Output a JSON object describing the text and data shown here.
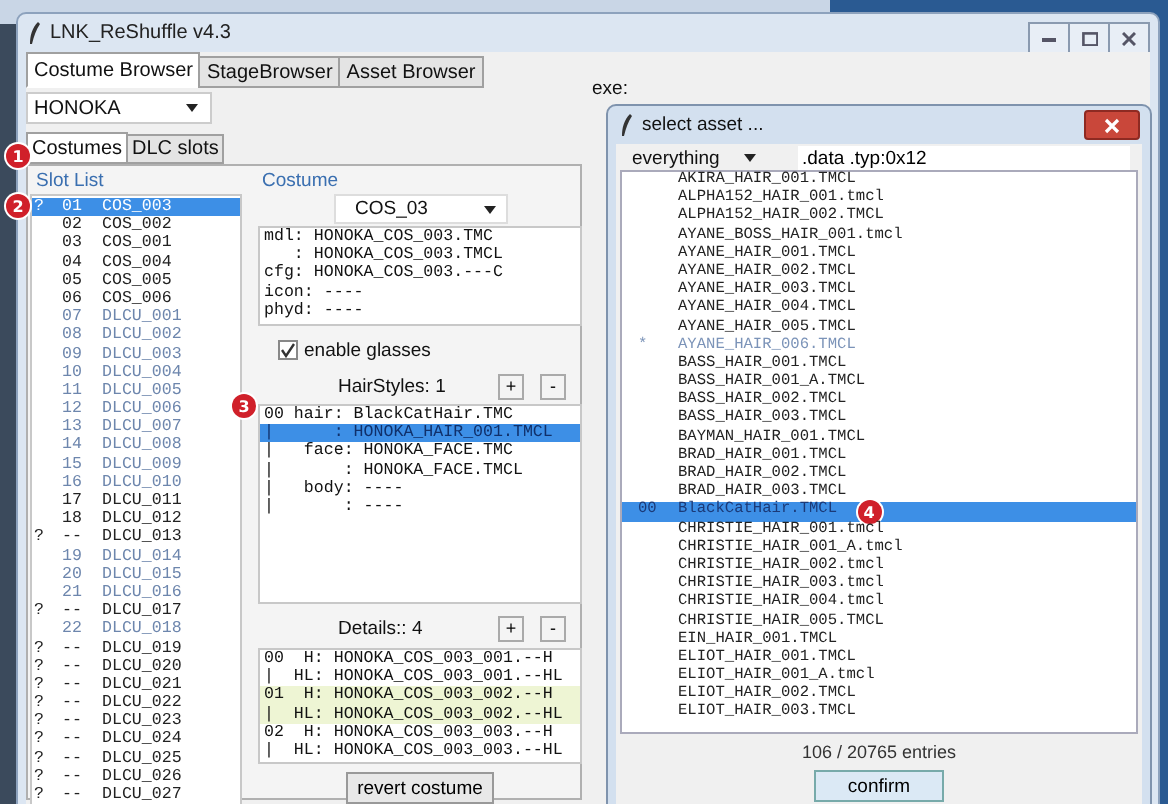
{
  "window": {
    "title": "LNK_ReShuffle v4.3"
  },
  "tabs": [
    {
      "label": "Costume Browser",
      "selected": true
    },
    {
      "label": "StageBrowser",
      "selected": false
    },
    {
      "label": "Asset Browser",
      "selected": false
    }
  ],
  "character": "HONOKA",
  "subtabs": [
    {
      "label": "Costumes",
      "selected": true
    },
    {
      "label": "DLC slots",
      "selected": false
    }
  ],
  "slot_list": {
    "title": "Slot List",
    "rows": [
      {
        "mark": "?",
        "number": "01",
        "name": "COS_003",
        "kind": "plain",
        "selected": true
      },
      {
        "number": "02",
        "name": "COS_002",
        "kind": "plain",
        "selected": false
      },
      {
        "number": "03",
        "name": "COS_001",
        "kind": "plain",
        "selected": false
      },
      {
        "number": "04",
        "name": "COS_004",
        "kind": "plain",
        "selected": false
      },
      {
        "number": "05",
        "name": "COS_005",
        "kind": "plain",
        "selected": false
      },
      {
        "number": "06",
        "name": "COS_006",
        "kind": "plain",
        "selected": false
      },
      {
        "number": "07",
        "name": "DLCU_001",
        "kind": "faded",
        "selected": false
      },
      {
        "number": "08",
        "name": "DLCU_002",
        "kind": "faded",
        "selected": false
      },
      {
        "number": "09",
        "name": "DLCU_003",
        "kind": "faded",
        "selected": false
      },
      {
        "number": "10",
        "name": "DLCU_004",
        "kind": "faded",
        "selected": false
      },
      {
        "number": "11",
        "name": "DLCU_005",
        "kind": "faded",
        "selected": false
      },
      {
        "number": "12",
        "name": "DLCU_006",
        "kind": "faded",
        "selected": false
      },
      {
        "number": "13",
        "name": "DLCU_007",
        "kind": "faded",
        "selected": false
      },
      {
        "number": "14",
        "name": "DLCU_008",
        "kind": "faded",
        "selected": false
      },
      {
        "number": "15",
        "name": "DLCU_009",
        "kind": "faded",
        "selected": false
      },
      {
        "number": "16",
        "name": "DLCU_010",
        "kind": "faded",
        "selected": false
      },
      {
        "number": "17",
        "name": "DLCU_011",
        "kind": "plain",
        "selected": false
      },
      {
        "number": "18",
        "name": "DLCU_012",
        "kind": "plain",
        "selected": false
      },
      {
        "mark": "?",
        "number": "--",
        "name": "DLCU_013",
        "kind": "plain",
        "selected": false
      },
      {
        "number": "19",
        "name": "DLCU_014",
        "kind": "faded",
        "selected": false
      },
      {
        "number": "20",
        "name": "DLCU_015",
        "kind": "faded",
        "selected": false
      },
      {
        "number": "21",
        "name": "DLCU_016",
        "kind": "faded",
        "selected": false
      },
      {
        "mark": "?",
        "number": "--",
        "name": "DLCU_017",
        "kind": "plain",
        "selected": false
      },
      {
        "number": "22",
        "name": "DLCU_018",
        "kind": "faded",
        "selected": false
      },
      {
        "mark": "?",
        "number": "--",
        "name": "DLCU_019",
        "kind": "plain",
        "selected": false
      },
      {
        "mark": "?",
        "number": "--",
        "name": "DLCU_020",
        "kind": "plain",
        "selected": false
      },
      {
        "mark": "?",
        "number": "--",
        "name": "DLCU_021",
        "kind": "plain",
        "selected": false
      },
      {
        "mark": "?",
        "number": "--",
        "name": "DLCU_022",
        "kind": "plain",
        "selected": false
      },
      {
        "mark": "?",
        "number": "--",
        "name": "DLCU_023",
        "kind": "plain",
        "selected": false
      },
      {
        "mark": "?",
        "number": "--",
        "name": "DLCU_024",
        "kind": "plain",
        "selected": false
      },
      {
        "mark": "?",
        "number": "--",
        "name": "DLCU_025",
        "kind": "plain",
        "selected": false
      },
      {
        "mark": "?",
        "number": "--",
        "name": "DLCU_026",
        "kind": "plain",
        "selected": false
      },
      {
        "mark": "?",
        "number": "--",
        "name": "DLCU_027",
        "kind": "plain",
        "selected": false
      }
    ]
  },
  "costume": {
    "title": "Costume",
    "selected": "COS_03",
    "info": [
      "mdl: HONOKA_COS_003.TMC",
      "   : HONOKA_COS_003.TMCL",
      "cfg: HONOKA_COS_003.---C",
      "icon: ----",
      "phyd: ----"
    ],
    "enable_glasses": {
      "label": "enable glasses",
      "checked": true
    },
    "hairstyles": {
      "label": "HairStyles: 1",
      "buttons": [
        "+",
        "-"
      ],
      "lines": [
        {
          "text": "00 hair: BlackCatHair.TMC",
          "selected": false
        },
        {
          "text": "|      : HONOKA_HAIR_001.TMCL",
          "selected": true
        },
        {
          "text": "|   face: HONOKA_FACE.TMC",
          "selected": false
        },
        {
          "text": "|       : HONOKA_FACE.TMCL",
          "selected": false
        },
        {
          "text": "|   body: ----",
          "selected": false
        },
        {
          "text": "|       : ----",
          "selected": false
        }
      ]
    },
    "details": {
      "label": "Details:: 4",
      "buttons": [
        "+",
        "-"
      ],
      "lines": [
        {
          "text": "00  H: HONOKA_COS_003_001.--H",
          "highlighted": false
        },
        {
          "text": "|  HL: HONOKA_COS_003_001.--HL",
          "highlighted": false
        },
        {
          "text": "01  H: HONOKA_COS_003_002.--H",
          "highlighted": true
        },
        {
          "text": "|  HL: HONOKA_COS_003_002.--HL",
          "highlighted": true
        },
        {
          "text": "02  H: HONOKA_COS_003_003.--H",
          "highlighted": false
        },
        {
          "text": "|  HL: HONOKA_COS_003_003.--HL",
          "highlighted": false
        }
      ]
    },
    "revert_button": "revert costume"
  },
  "exe_label": "exe:",
  "dialog": {
    "title": "select asset ...",
    "filter": "everything",
    "query": ".data .typ:0x12",
    "assets": [
      {
        "name": "AKIRA_HAIR_001.TMCL",
        "kind": "plain",
        "selected": false
      },
      {
        "name": "ALPHA152_HAIR_001.tmcl",
        "kind": "plain",
        "selected": false
      },
      {
        "name": "ALPHA152_HAIR_002.TMCL",
        "kind": "plain",
        "selected": false
      },
      {
        "name": "AYANE_BOSS_HAIR_001.tmcl",
        "kind": "plain",
        "selected": false
      },
      {
        "name": "AYANE_HAIR_001.TMCL",
        "kind": "plain",
        "selected": false
      },
      {
        "name": "AYANE_HAIR_002.TMCL",
        "kind": "plain",
        "selected": false
      },
      {
        "name": "AYANE_HAIR_003.TMCL",
        "kind": "plain",
        "selected": false
      },
      {
        "name": "AYANE_HAIR_004.TMCL",
        "kind": "plain",
        "selected": false
      },
      {
        "name": "AYANE_HAIR_005.TMCL",
        "kind": "plain",
        "selected": false
      },
      {
        "mark": "*",
        "name": "AYANE_HAIR_006.TMCL",
        "kind": "faded",
        "selected": false
      },
      {
        "name": "BASS_HAIR_001.TMCL",
        "kind": "plain",
        "selected": false
      },
      {
        "name": "BASS_HAIR_001_A.TMCL",
        "kind": "plain",
        "selected": false
      },
      {
        "name": "BASS_HAIR_002.TMCL",
        "kind": "plain",
        "selected": false
      },
      {
        "name": "BASS_HAIR_003.TMCL",
        "kind": "plain",
        "selected": false
      },
      {
        "name": "BAYMAN_HAIR_001.TMCL",
        "kind": "plain",
        "selected": false
      },
      {
        "name": "BRAD_HAIR_001.TMCL",
        "kind": "plain",
        "selected": false
      },
      {
        "name": "BRAD_HAIR_002.TMCL",
        "kind": "plain",
        "selected": false
      },
      {
        "name": "BRAD_HAIR_003.TMCL",
        "kind": "plain",
        "selected": false
      },
      {
        "mark": "00",
        "name": "BlackCatHair.TMCL",
        "kind": "plain",
        "selected": true
      },
      {
        "name": "CHRISTIE_HAIR_001.tmcl",
        "kind": "plain",
        "selected": false
      },
      {
        "name": "CHRISTIE_HAIR_001_A.tmcl",
        "kind": "plain",
        "selected": false
      },
      {
        "name": "CHRISTIE_HAIR_002.tmcl",
        "kind": "plain",
        "selected": false
      },
      {
        "name": "CHRISTIE_HAIR_003.tmcl",
        "kind": "plain",
        "selected": false
      },
      {
        "name": "CHRISTIE_HAIR_004.tmcl",
        "kind": "plain",
        "selected": false
      },
      {
        "name": "CHRISTIE_HAIR_005.TMCL",
        "kind": "plain",
        "selected": false
      },
      {
        "name": "EIN_HAIR_001.TMCL",
        "kind": "plain",
        "selected": false
      },
      {
        "name": "ELIOT_HAIR_001.TMCL",
        "kind": "plain",
        "selected": false
      },
      {
        "name": "ELIOT_HAIR_001_A.tmcl",
        "kind": "plain",
        "selected": false
      },
      {
        "name": "ELIOT_HAIR_002.TMCL",
        "kind": "plain",
        "selected": false
      },
      {
        "name": "ELIOT_HAIR_003.TMCL",
        "kind": "plain",
        "selected": false
      }
    ],
    "count": "106 / 20765 entries",
    "confirm_button": "confirm"
  },
  "badges": [
    "1",
    "2",
    "3",
    "4"
  ]
}
